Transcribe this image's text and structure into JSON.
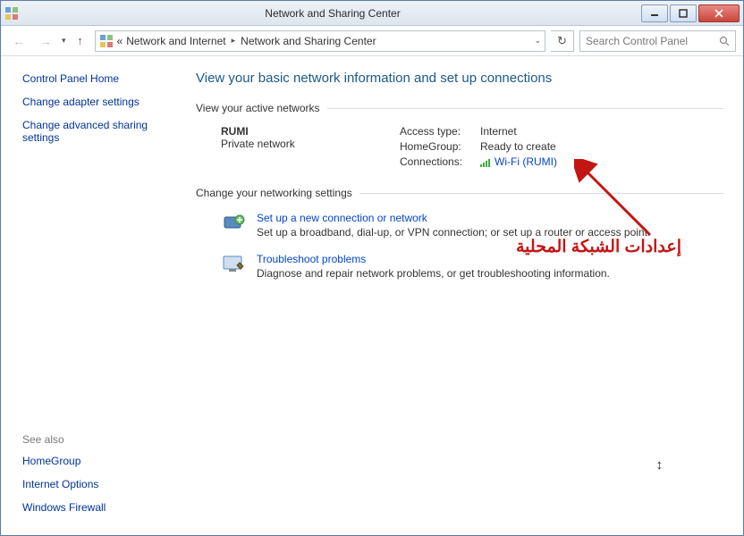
{
  "titlebar": {
    "title": "Network and Sharing Center"
  },
  "toolbar": {
    "breadcrumb_prefix": "«",
    "breadcrumb1": "Network and Internet",
    "breadcrumb2": "Network and Sharing Center",
    "search_placeholder": "Search Control Panel"
  },
  "sidebar": {
    "home": "Control Panel Home",
    "link1": "Change adapter settings",
    "link2": "Change advanced sharing settings",
    "see_also_label": "See also",
    "see1": "HomeGroup",
    "see2": "Internet Options",
    "see3": "Windows Firewall"
  },
  "main": {
    "heading": "View your basic network information and set up connections",
    "active_label": "View your active networks",
    "net_name": "RUMI",
    "net_type": "Private network",
    "access_k": "Access type:",
    "access_v": "Internet",
    "homegroup_k": "HomeGroup:",
    "homegroup_v": "Ready to create",
    "conn_k": "Connections:",
    "conn_v": "Wi-Fi (RUMI)",
    "change_label": "Change your networking settings",
    "setup_title": "Set up a new connection or network",
    "setup_desc": "Set up a broadband, dial-up, or VPN connection; or set up a router or access point.",
    "trouble_title": "Troubleshoot problems",
    "trouble_desc": "Diagnose and repair network problems, or get troubleshooting information."
  },
  "annotation": {
    "text": "إعدادات الشبكة المحلية"
  }
}
